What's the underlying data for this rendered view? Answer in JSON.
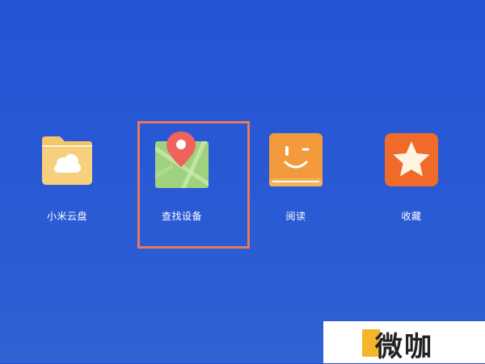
{
  "apps": [
    {
      "id": "cloud",
      "label": "小米云盘",
      "icon": "folder-cloud-icon",
      "color": "#f5c56a"
    },
    {
      "id": "find",
      "label": "查找设备",
      "icon": "map-pin-icon",
      "color": "#9fd17e"
    },
    {
      "id": "read",
      "label": "阅读",
      "icon": "smile-book-icon",
      "color": "#f39a3c"
    },
    {
      "id": "fav",
      "label": "收藏",
      "icon": "star-icon",
      "color": "#f06b2a"
    }
  ],
  "highlight": {
    "color": "#e8795e",
    "target": "find"
  },
  "watermark": {
    "text": "微咖"
  },
  "background": "#2757d4"
}
